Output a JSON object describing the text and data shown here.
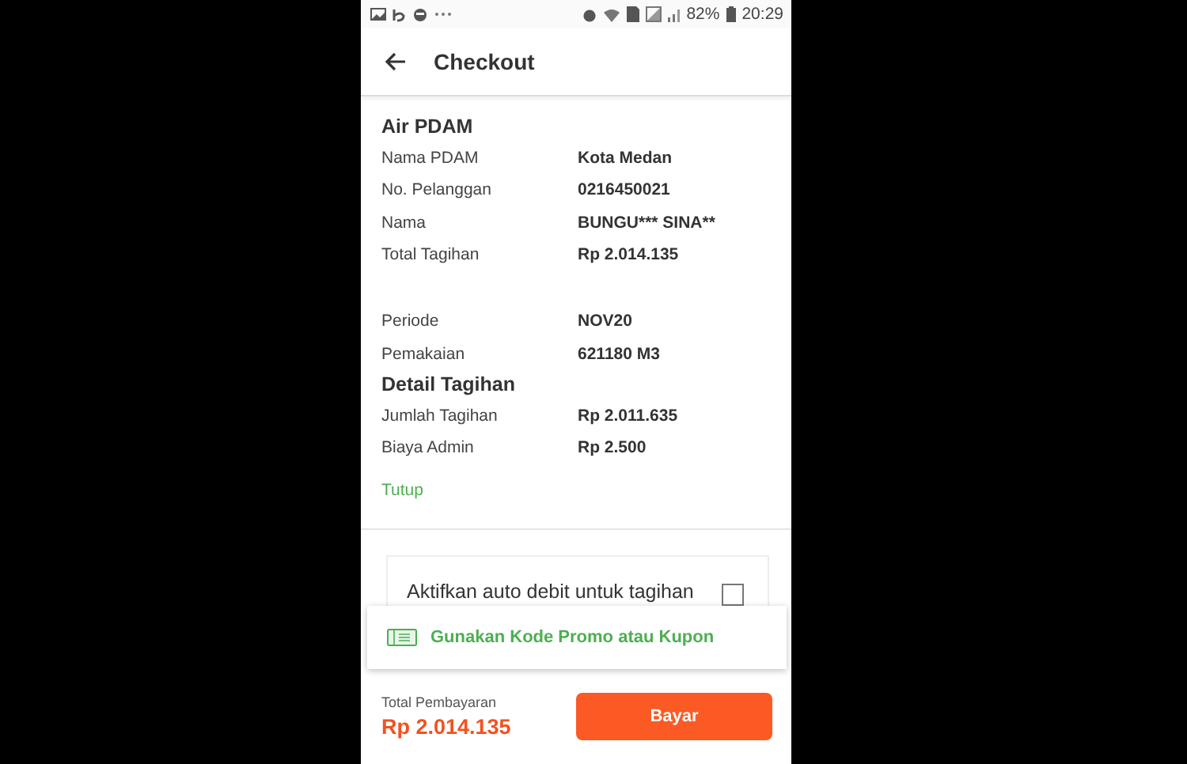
{
  "status_bar": {
    "battery": "82%",
    "time": "20:29"
  },
  "header": {
    "title": "Checkout"
  },
  "groups": [
    {
      "title": "Air PDAM",
      "rows": [
        {
          "label": "Nama PDAM",
          "value": "Kota Medan"
        },
        {
          "label": "No. Pelanggan",
          "value": "0216450021"
        },
        {
          "label": "Nama",
          "value": "BUNGU*** SINA**"
        },
        {
          "label": "Total Tagihan",
          "value": "Rp 2.014.135"
        }
      ]
    },
    {
      "rows": [
        {
          "label": "Periode",
          "value": "NOV20"
        },
        {
          "label": "Pemakaian",
          "value": "621180 M3"
        }
      ]
    },
    {
      "title": "Detail Tagihan",
      "rows": [
        {
          "label": "Jumlah Tagihan",
          "value": "Rp 2.011.635"
        },
        {
          "label": "Biaya Admin",
          "value": "Rp 2.500"
        }
      ]
    }
  ],
  "toggle_link": "Tutup",
  "auto_debit": {
    "label": "Aktifkan auto debit untuk tagihan",
    "checked": false
  },
  "promo": {
    "label": "Gunakan Kode Promo atau Kupon"
  },
  "footer": {
    "total_label": "Total Pembayaran",
    "total": "Rp 2.014.135",
    "button": "Bayar"
  }
}
